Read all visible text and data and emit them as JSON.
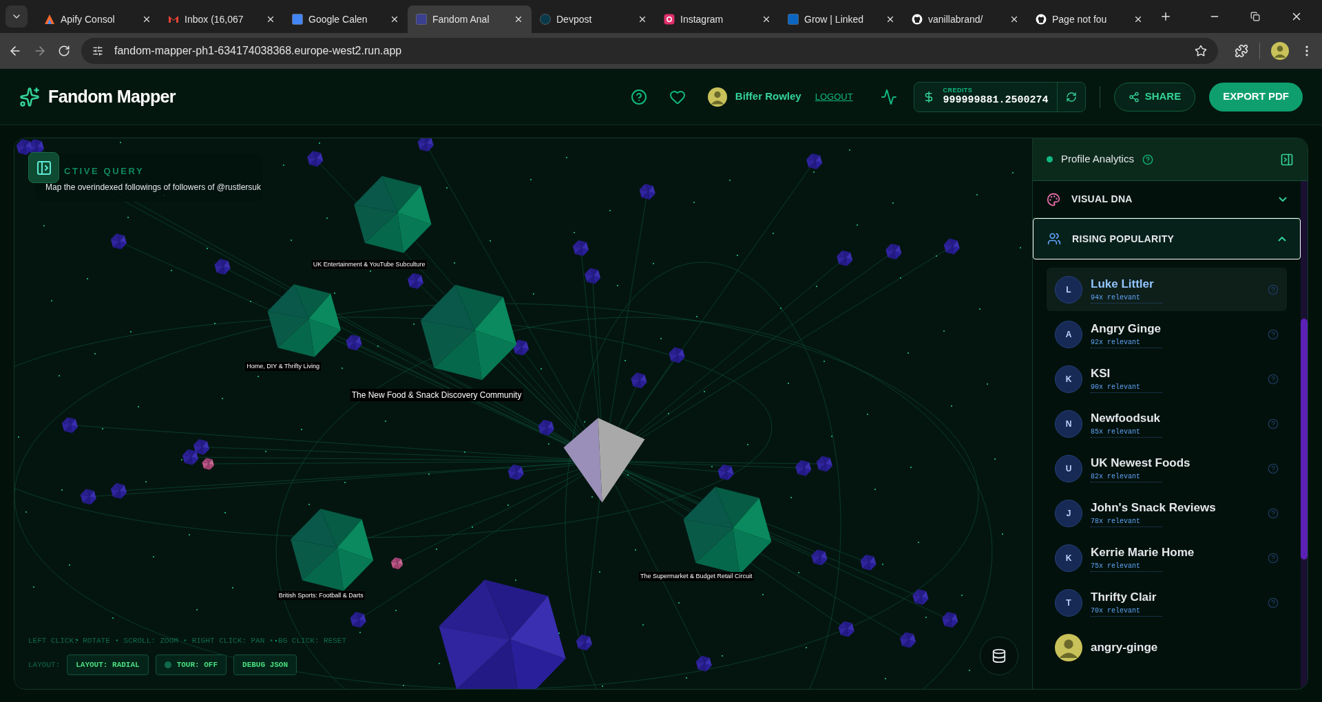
{
  "browser": {
    "tabs": [
      {
        "title": "Apify Consol",
        "selected": false
      },
      {
        "title": "Inbox (16,067",
        "selected": false
      },
      {
        "title": "Google Calen",
        "selected": false
      },
      {
        "title": "Fandom Anal",
        "selected": true
      },
      {
        "title": "Devpost",
        "selected": false
      },
      {
        "title": "Instagram",
        "selected": false
      },
      {
        "title": "Grow | Linked",
        "selected": false
      },
      {
        "title": "vanillabrand/",
        "selected": false
      },
      {
        "title": "Page not fou",
        "selected": false
      }
    ],
    "url": "fandom-mapper-ph1-634174038368.europe-west2.run.app"
  },
  "app": {
    "title": "Fandom Mapper",
    "user": "Biffer Rowley",
    "logout": "LOGOUT",
    "credits": {
      "label": "CREDITS",
      "value": "999999881.2500274"
    },
    "share": "SHARE",
    "export": "EXPORT PDF"
  },
  "canvas": {
    "query": {
      "heading": "CTIVE QUERY",
      "text": "Map the overindexed followings of followers of @rustlersuk"
    },
    "clusters": [
      {
        "label": "UK Entertainment & YouTube Subculture"
      },
      {
        "label": "Home, DIY & Thrifty Living"
      },
      {
        "label": "The New Food & Snack Discovery Community"
      },
      {
        "label": "British Sports: Football & Darts"
      },
      {
        "label": "The Supermarket & Budget Retail Circuit"
      }
    ],
    "hint": "LEFT CLICK: ROTATE • SCROLL: ZOOM • RIGHT CLICK: PAN • BG CLICK: RESET",
    "layout_label": "LAYOUT:",
    "controls": [
      {
        "label": "LAYOUT: RADIAL",
        "kind": "plain"
      },
      {
        "label": "TOUR: OFF",
        "kind": "toggle",
        "on": false
      },
      {
        "label": "DEBUG JSON",
        "kind": "plain"
      }
    ]
  },
  "panel": {
    "title": "Profile Analytics",
    "sections": [
      {
        "title": "VISUAL DNA",
        "kind": "palette",
        "expanded": false
      },
      {
        "title": "RISING POPULARITY",
        "kind": "people",
        "expanded": true
      }
    ],
    "profiles": [
      {
        "kind": "letter",
        "initial": "L",
        "name": "Luke Littler",
        "relevance": "94x relevant",
        "selected": true
      },
      {
        "kind": "letter",
        "initial": "A",
        "name": "Angry Ginge",
        "relevance": "92x relevant",
        "selected": false
      },
      {
        "kind": "letter",
        "initial": "K",
        "name": "KSI",
        "relevance": "90x relevant",
        "selected": false
      },
      {
        "kind": "letter",
        "initial": "N",
        "name": "Newfoodsuk",
        "relevance": "85x relevant",
        "selected": false
      },
      {
        "kind": "letter",
        "initial": "U",
        "name": "UK Newest Foods",
        "relevance": "82x relevant",
        "selected": false
      },
      {
        "kind": "letter",
        "initial": "J",
        "name": "John's Snack Reviews",
        "relevance": "78x relevant",
        "selected": false
      },
      {
        "kind": "letter",
        "initial": "K",
        "name": "Kerrie Marie Home",
        "relevance": "75x relevant",
        "selected": false
      },
      {
        "kind": "letter",
        "initial": "T",
        "name": "Thrifty Clair",
        "relevance": "70x relevant",
        "selected": false
      },
      {
        "kind": "photo",
        "name": "angry-ginge",
        "selected": false
      }
    ]
  }
}
